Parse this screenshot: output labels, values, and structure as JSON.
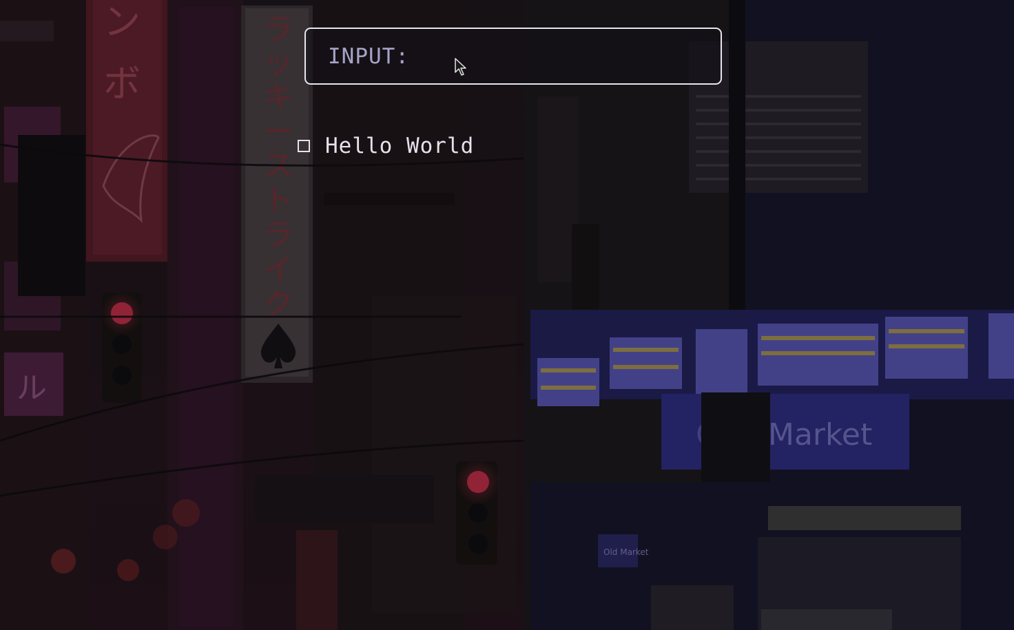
{
  "input": {
    "prompt": "INPUT:",
    "value": "",
    "placeholder": ""
  },
  "todos": [
    {
      "label": "Hello World",
      "checked": false
    }
  ],
  "wallpaper": {
    "description_colors": {
      "base": "#141216",
      "neon_red": "#7a2230",
      "neon_magenta": "#6a2a5c",
      "neon_blue": "#3a3a9a",
      "neon_yellow": "#b8a35a"
    },
    "signs": {
      "vertical_sign": "ラッキーストライク",
      "left_sign": "ンボ",
      "market_sign": "Market",
      "street_sign": "Old Market",
      "small_sign": "ル"
    }
  }
}
